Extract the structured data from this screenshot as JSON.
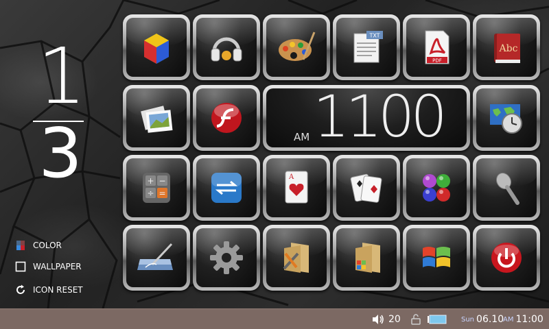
{
  "page": {
    "current": "1",
    "total": "3"
  },
  "side_menu": {
    "color_label": "COLOR",
    "wallpaper_label": "WALLPAPER",
    "icon_reset_label": "ICON RESET"
  },
  "clock_widget": {
    "time": "1100",
    "ampm": "AM"
  },
  "apps": [
    {
      "icon": "media-player-icon"
    },
    {
      "icon": "headphones-icon"
    },
    {
      "icon": "paint-palette-icon"
    },
    {
      "icon": "text-document-icon",
      "badge": "TXT"
    },
    {
      "icon": "pdf-document-icon",
      "badge": "PDF"
    },
    {
      "icon": "dictionary-book-icon",
      "badge": "Abc"
    },
    {
      "icon": "photo-gallery-icon"
    },
    {
      "icon": "flash-player-icon"
    },
    {
      "icon": "world-clock-icon"
    },
    {
      "icon": "calculator-icon"
    },
    {
      "icon": "sync-transfer-icon"
    },
    {
      "icon": "solitaire-card-icon",
      "badge": "A"
    },
    {
      "icon": "poker-cards-icon"
    },
    {
      "icon": "color-balls-game-icon"
    },
    {
      "icon": "microphone-icon"
    },
    {
      "icon": "notepad-pen-icon"
    },
    {
      "icon": "settings-gear-icon"
    },
    {
      "icon": "folder-tools-icon"
    },
    {
      "icon": "folder-windows-icon"
    },
    {
      "icon": "windows-logo-icon"
    },
    {
      "icon": "power-icon"
    }
  ],
  "status_bar": {
    "volume": "20",
    "day": "Sun",
    "date": "06.10",
    "ampm": "AM",
    "time": "11:00"
  },
  "colors": {
    "status_bar_bg": "#7c6963",
    "accent_red": "#c8202a",
    "accent_blue": "#3a8be0"
  }
}
